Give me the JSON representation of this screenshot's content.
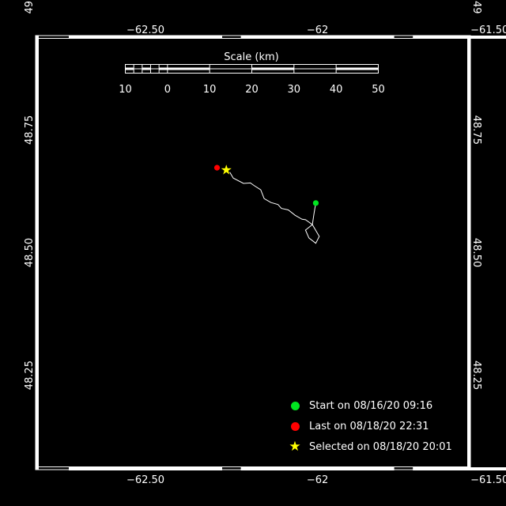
{
  "map": {
    "lon_range": [
      -62.8125,
      -61.5625
    ],
    "lat_range": [
      48.0625,
      48.9375
    ]
  },
  "axis": {
    "lon_ticks": [
      {
        "value": -62.5,
        "label": "−62.50"
      },
      {
        "value": -62.0,
        "label": "−62"
      },
      {
        "value": -61.5,
        "label": "−61.50"
      }
    ],
    "lat_ticks": [
      {
        "value": 49.0,
        "label": "49"
      },
      {
        "value": 48.75,
        "label": "48.75"
      },
      {
        "value": 48.5,
        "label": "48.50"
      },
      {
        "value": 48.25,
        "label": "48.25"
      }
    ]
  },
  "scale_bar": {
    "title": "Scale (km)",
    "tick_labels": [
      "10",
      "0",
      "10",
      "20",
      "30",
      "40",
      "50"
    ]
  },
  "track": {
    "points": [
      [
        -62.255,
        48.664
      ],
      [
        -62.245,
        48.652
      ],
      [
        -62.215,
        48.641
      ],
      [
        -62.195,
        48.642
      ],
      [
        -62.185,
        48.637
      ],
      [
        -62.165,
        48.628
      ],
      [
        -62.155,
        48.61
      ],
      [
        -62.135,
        48.602
      ],
      [
        -62.115,
        48.598
      ],
      [
        -62.105,
        48.59
      ],
      [
        -62.085,
        48.587
      ],
      [
        -62.065,
        48.576
      ],
      [
        -62.045,
        48.568
      ],
      [
        -62.035,
        48.567
      ],
      [
        -62.015,
        48.557
      ],
      [
        -61.995,
        48.533
      ],
      [
        -62.005,
        48.519
      ],
      [
        -62.025,
        48.53
      ],
      [
        -62.035,
        48.546
      ],
      [
        -62.015,
        48.557
      ],
      [
        -62.01,
        48.58
      ],
      [
        -62.005,
        48.601
      ]
    ],
    "color": "#ffffff"
  },
  "markers": {
    "start": {
      "lon": -62.005,
      "lat": 48.601,
      "color": "#00e620"
    },
    "last": {
      "lon": -62.292,
      "lat": 48.673,
      "color": "#ff0000"
    },
    "selected": {
      "lon": -62.265,
      "lat": 48.669,
      "color": "#ffff00"
    }
  },
  "legend": {
    "start": {
      "label": "Start on 08/16/20 09:16",
      "color": "#00e620"
    },
    "last": {
      "label": "Last on 08/18/20 22:31",
      "color": "#ff0000"
    },
    "selected": {
      "label": "Selected on 08/18/20 20:01",
      "color": "#ffff00"
    }
  }
}
